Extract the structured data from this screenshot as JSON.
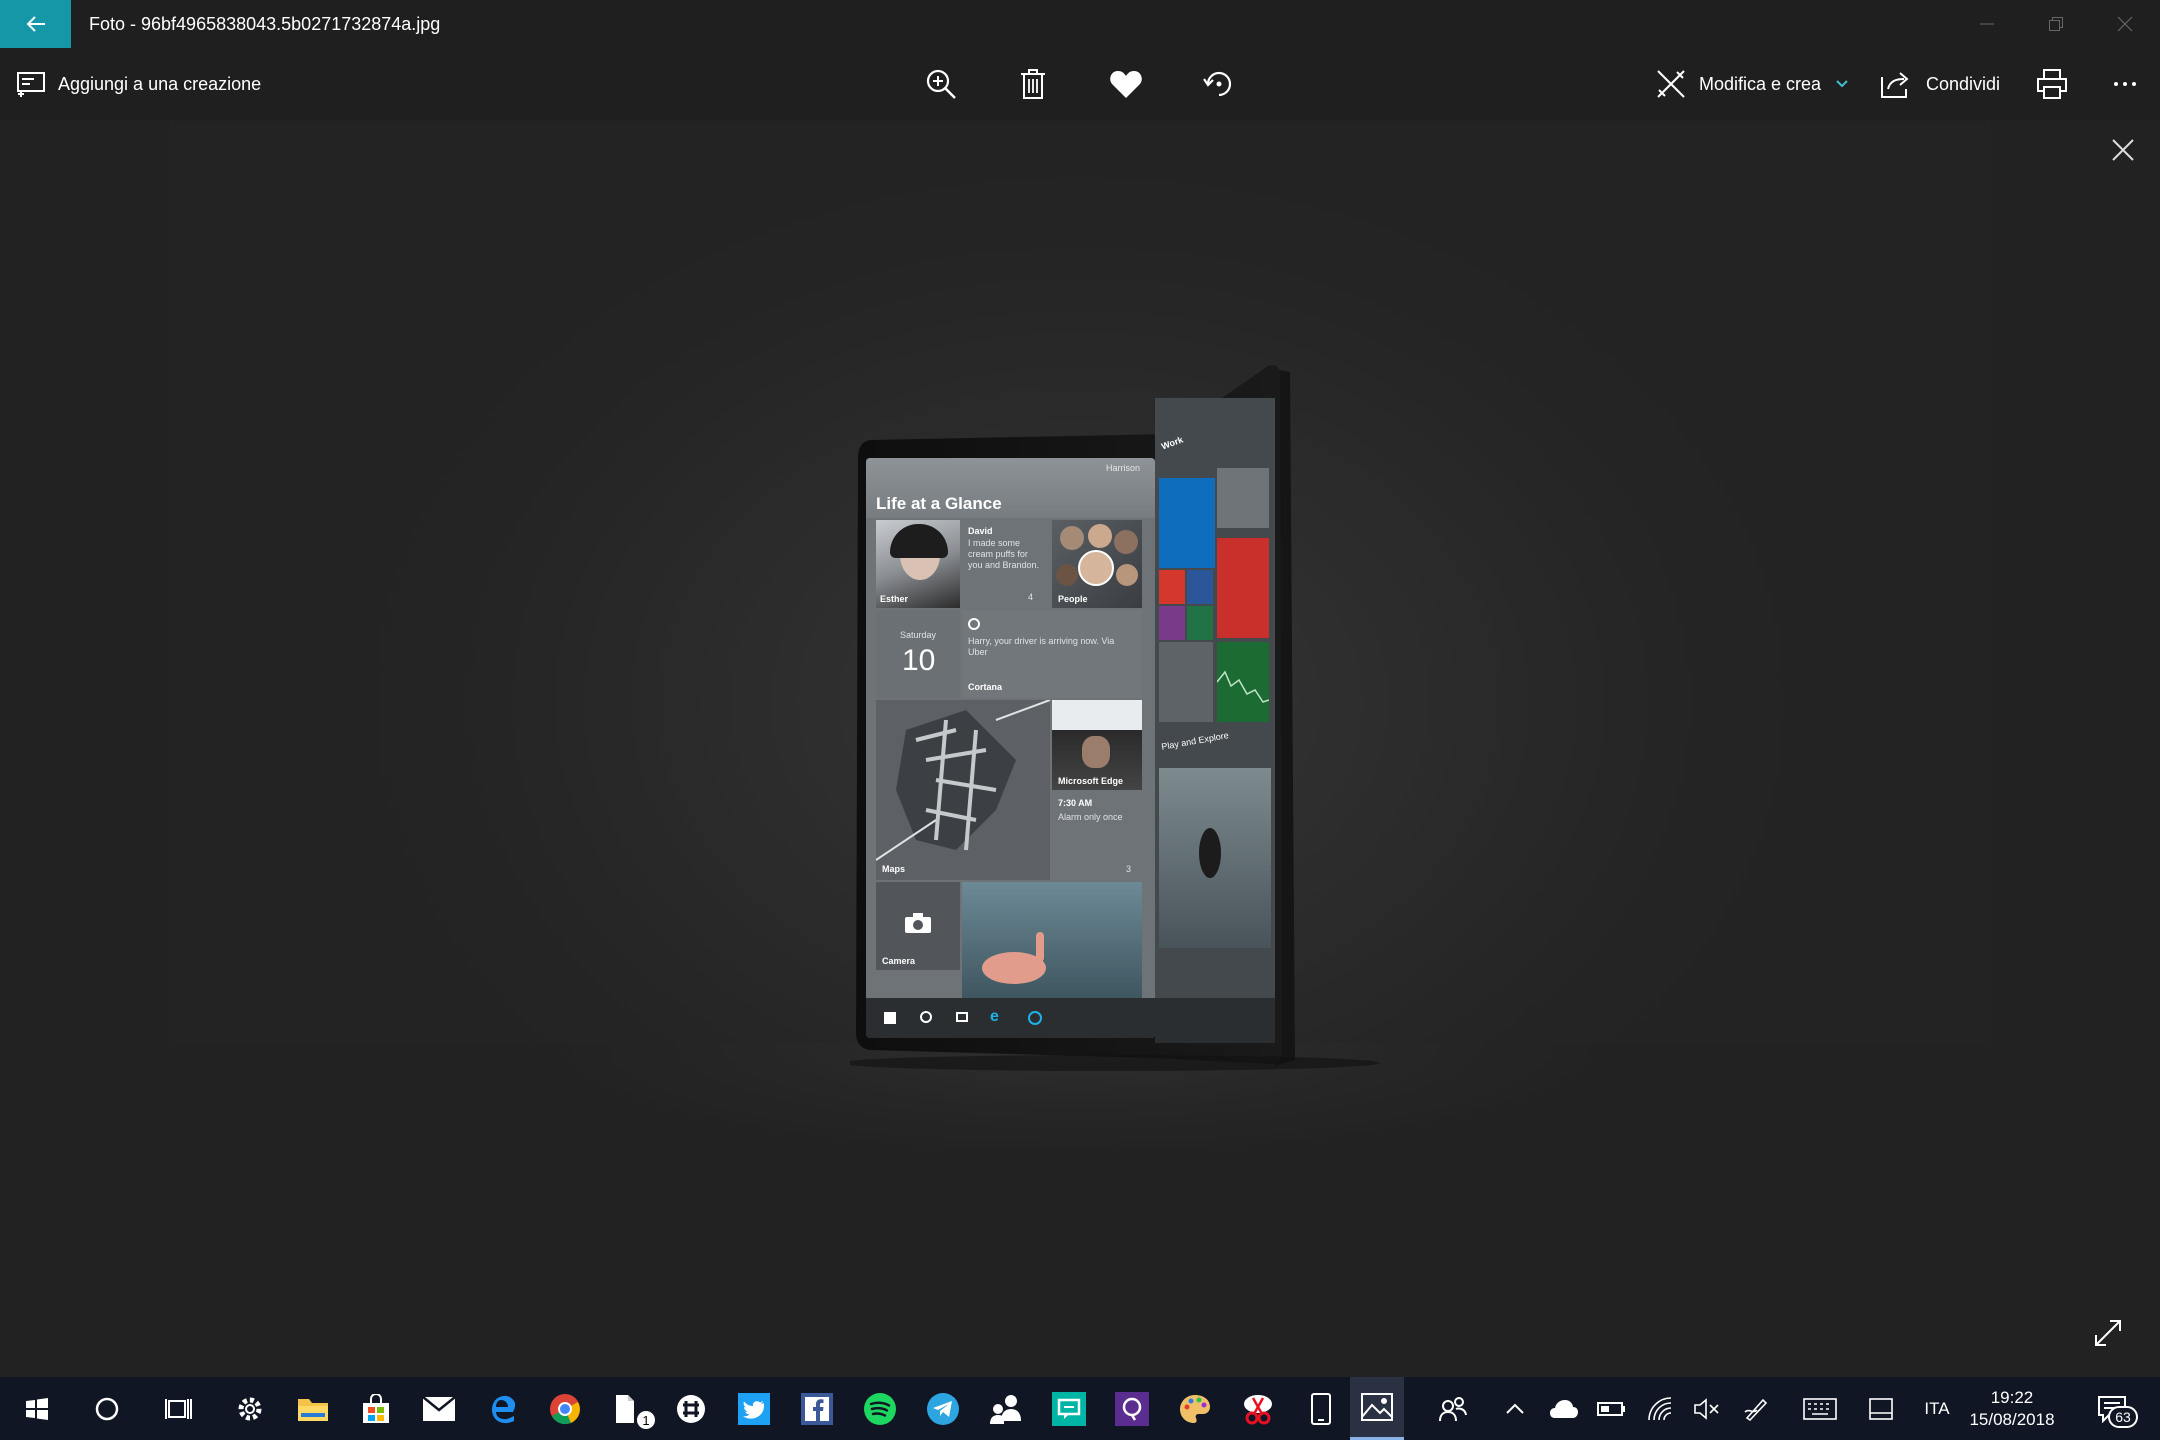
{
  "window": {
    "title": "Foto - 96bf4965838043.5b0271732874a.jpg"
  },
  "toolbar": {
    "add_to_creation": "Aggiungi a una creazione",
    "edit_create": "Modifica e crea",
    "share": "Condividi"
  },
  "photo": {
    "screen": {
      "header": "Life at a Glance",
      "status_right": "Harrison",
      "tiles": {
        "esther": "Esther",
        "david_name": "David",
        "david_msg": "I made some cream puffs for you and Brandon.",
        "david_count": "4",
        "people": "People",
        "calendar_day": "Saturday",
        "calendar_date": "10",
        "cortana_msg": "Harry, your driver is arriving now. Via Uber",
        "cortana": "Cortana",
        "edge": "Microsoft Edge",
        "alarm_time": "7:30 AM",
        "alarm_note": "Alarm only once",
        "alarm_count": "3",
        "maps": "Maps",
        "camera": "Camera"
      },
      "right_panel": {
        "work": "Work",
        "play": "Play and Explore"
      }
    }
  },
  "taskbar": {
    "badge_files": "1",
    "language": "ITA",
    "time": "19:22",
    "date": "15/08/2018",
    "notification_count": "63"
  },
  "colors": {
    "accent": "#1597a7",
    "background": "#202020",
    "taskbar": "#101624"
  }
}
